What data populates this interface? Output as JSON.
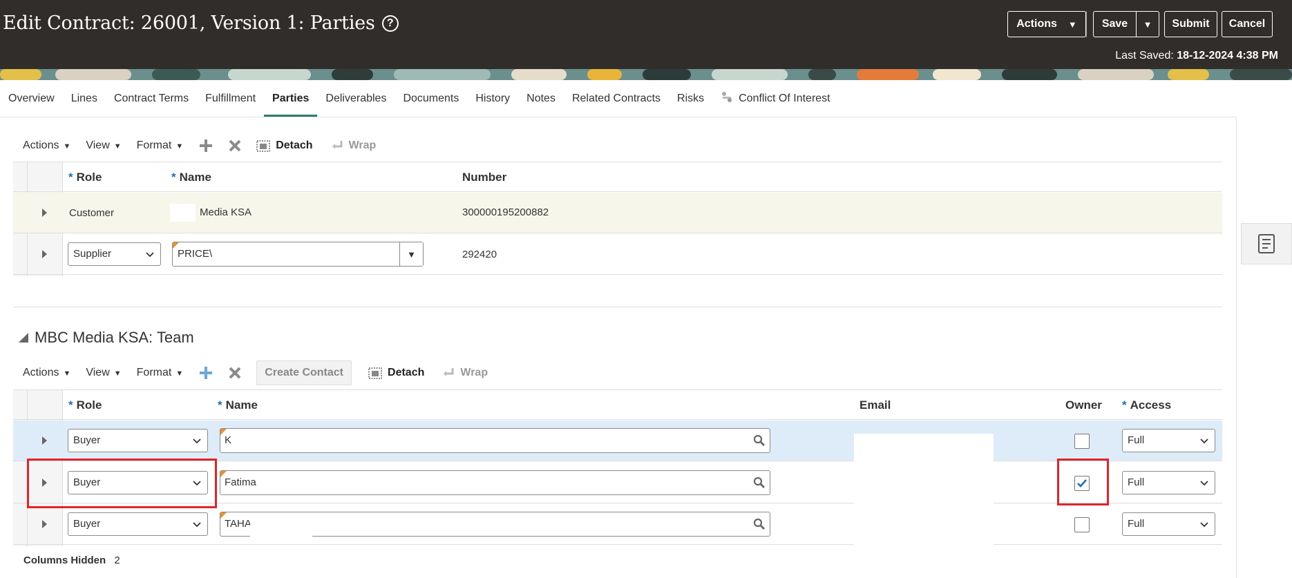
{
  "header": {
    "title": "Edit Contract: 26001, Version 1: Parties",
    "actions_label": "Actions",
    "save_label": "Save",
    "submit_label": "Submit",
    "cancel_label": "Cancel",
    "last_saved_label": "Last Saved:",
    "last_saved_value": "18-12-2024 4:38 PM"
  },
  "tabs": [
    {
      "label": "Overview"
    },
    {
      "label": "Lines"
    },
    {
      "label": "Contract Terms"
    },
    {
      "label": "Fulfillment"
    },
    {
      "label": "Parties"
    },
    {
      "label": "Deliverables"
    },
    {
      "label": "Documents"
    },
    {
      "label": "History"
    },
    {
      "label": "Notes"
    },
    {
      "label": "Related Contracts"
    },
    {
      "label": "Risks"
    },
    {
      "label": "Conflict Of Interest"
    }
  ],
  "parties": {
    "toolbar": {
      "actions": "Actions",
      "view": "View",
      "format": "Format",
      "detach": "Detach",
      "wrap": "Wrap"
    },
    "columns": {
      "role": "Role",
      "name": "Name",
      "number": "Number"
    },
    "rows": [
      {
        "role": "Customer",
        "name": "Media KSA",
        "number": "300000195200882"
      },
      {
        "role": "Supplier",
        "name": "PRICE\\",
        "number": "292420"
      }
    ]
  },
  "team": {
    "title": "MBC Media KSA: Team",
    "toolbar": {
      "actions": "Actions",
      "view": "View",
      "format": "Format",
      "create_contact": "Create Contact",
      "detach": "Detach",
      "wrap": "Wrap"
    },
    "columns": {
      "role": "Role",
      "name": "Name",
      "email": "Email",
      "owner": "Owner",
      "access": "Access"
    },
    "rows": [
      {
        "role": "Buyer",
        "name": "K",
        "owner": false,
        "access": "Full"
      },
      {
        "role": "Buyer",
        "name": "Fatima",
        "owner": true,
        "access": "Full"
      },
      {
        "role": "Buyer",
        "name": "TAHA",
        "owner": false,
        "access": "Full"
      }
    ],
    "columns_hidden_label": "Columns Hidden",
    "columns_hidden_count": "2"
  },
  "colors": {
    "header_bg": "#312d2a",
    "active_tab": "#2d7d6e",
    "required": "#1f6fb5",
    "highlight": "#e0242a",
    "selected_row": "#deecf9"
  }
}
